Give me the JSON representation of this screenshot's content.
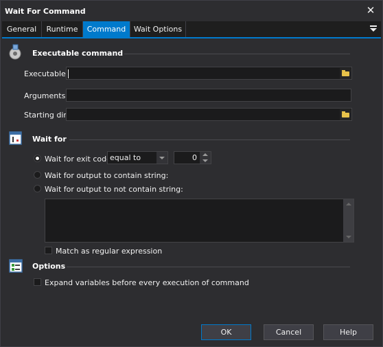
{
  "window": {
    "title": "Wait For Command"
  },
  "tabs": [
    {
      "label": "General"
    },
    {
      "label": "Runtime"
    },
    {
      "label": "Command",
      "active": true
    },
    {
      "label": "Wait Options"
    }
  ],
  "executable_section": {
    "title": "Executable command",
    "executable_label": "Executable:",
    "executable_value": "",
    "arguments_label": "Arguments:",
    "arguments_value": "",
    "starting_dir_label": "Starting dir:",
    "starting_dir_value": ""
  },
  "wait_section": {
    "title": "Wait for",
    "exit_code_label": "Wait for exit code",
    "exit_code_selected": true,
    "comparison_value": "equal to",
    "exit_code_value": "0",
    "contain_label": "Wait for output to contain string:",
    "not_contain_label": "Wait for output to not contain string:",
    "output_text": "",
    "regex_label": "Match as regular expression",
    "regex_checked": false
  },
  "options_section": {
    "title": "Options",
    "expand_label": "Expand variables before every execution of command",
    "expand_checked": false
  },
  "buttons": {
    "ok": "OK",
    "cancel": "Cancel",
    "help": "Help"
  },
  "colors": {
    "accent": "#007acc",
    "background": "#2d2d30",
    "input": "#1b1b1c"
  }
}
